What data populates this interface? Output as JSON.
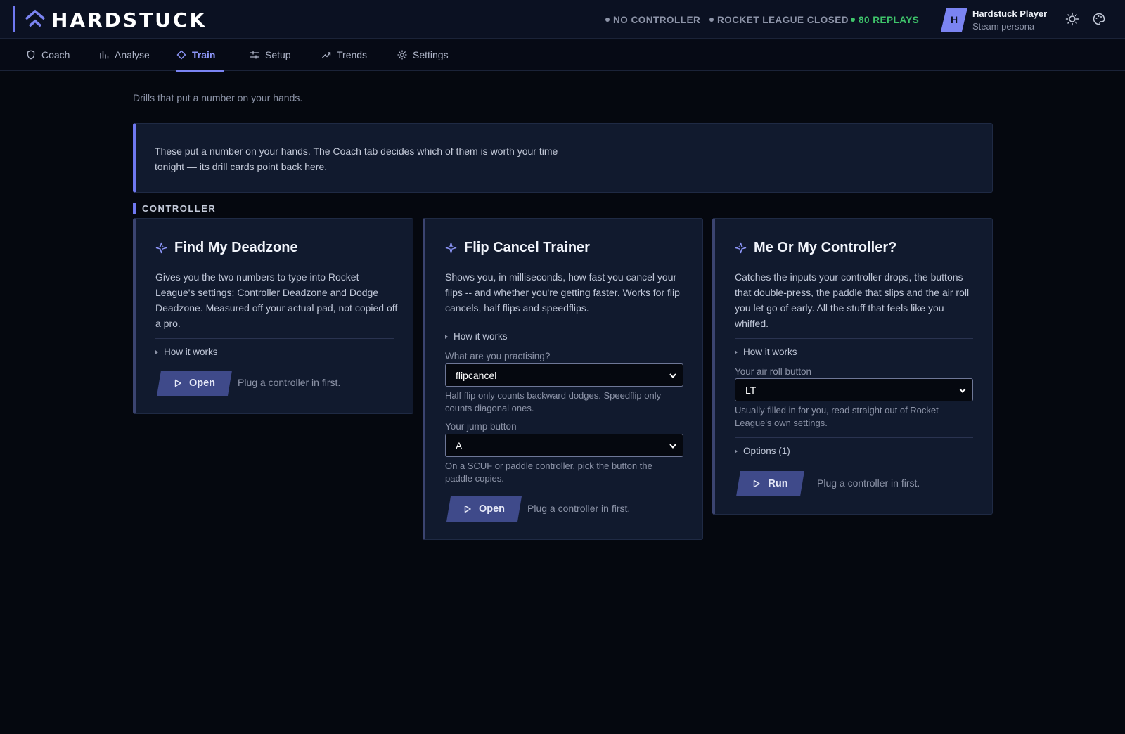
{
  "app": {
    "brand_name": "HARDSTUCK",
    "colors": {
      "accent": "#7b84f2",
      "background": "#05080f",
      "panel": "#111a2e",
      "ok": "#3fc56b",
      "muted": "#8d94a8"
    }
  },
  "header": {
    "status": [
      {
        "label": "NO CONTROLLER",
        "state": "inactive"
      },
      {
        "label": "ROCKET LEAGUE CLOSED",
        "state": "inactive"
      },
      {
        "label": "80 REPLAYS",
        "state": "active"
      }
    ],
    "user": {
      "avatar_letter": "H",
      "name": "Hardstuck Player",
      "subtitle": "Steam persona"
    },
    "icons": [
      "sun-icon",
      "palette-icon"
    ]
  },
  "nav": {
    "tabs": [
      {
        "label": "Coach",
        "icon": "shield-icon",
        "active": false
      },
      {
        "label": "Analyse",
        "icon": "bar-chart-icon",
        "active": false
      },
      {
        "label": "Train",
        "icon": "diamond-icon",
        "active": true
      },
      {
        "label": "Setup",
        "icon": "sliders-icon",
        "active": false
      },
      {
        "label": "Trends",
        "icon": "trend-up-icon",
        "active": false
      },
      {
        "label": "Settings",
        "icon": "gear-icon",
        "active": false
      }
    ]
  },
  "main": {
    "intro": "Drills that put a number on your hands.",
    "notice": "These put a number on your hands. The Coach tab decides which of them is worth your time tonight — its drill cards point back here.",
    "section_label": "CONTROLLER",
    "cards": [
      {
        "title": "Find My Deadzone",
        "description": "Gives you the two numbers to type into Rocket League's settings: Controller Deadzone and Dodge Deadzone. Measured off your actual pad, not copied off a pro.",
        "how_it_works": "How it works",
        "button_label": "Open",
        "button_note": "Plug a controller in first."
      },
      {
        "title": "Flip Cancel Trainer",
        "description": "Shows you, in milliseconds, how fast you cancel your flips -- and whether you're getting faster. Works for flip cancels, half flips and speedflips.",
        "how_it_works": "How it works",
        "field1_label": "What are you practising?",
        "field1_value": "flipcancel",
        "field1_hint": "Half flip only counts backward dodges. Speedflip only counts diagonal ones.",
        "field2_label": "Your jump button",
        "field2_value": "A",
        "field2_hint": "On a SCUF or paddle controller, pick the button the paddle copies.",
        "button_label": "Open",
        "button_note": "Plug a controller in first."
      },
      {
        "title": "Me Or My Controller?",
        "description": "Catches the inputs your controller drops, the buttons that double-press, the paddle that slips and the air roll you let go of early. All the stuff that feels like you whiffed.",
        "how_it_works": "How it works",
        "field1_label": "Your air roll button",
        "field1_value": "LT",
        "field1_hint": "Usually filled in for you, read straight out of Rocket League's own settings.",
        "options_label": "Options (1)",
        "button_label": "Run",
        "button_note": "Plug a controller in first."
      }
    ]
  }
}
